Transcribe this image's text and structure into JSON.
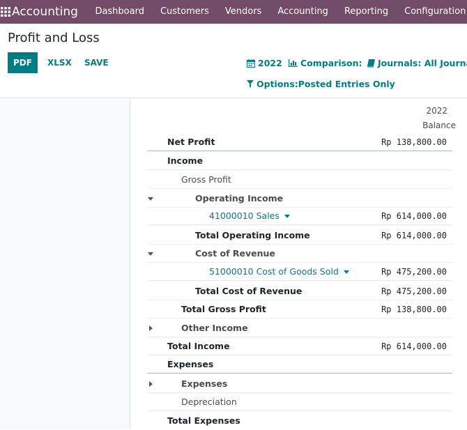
{
  "nav": {
    "brand": "Accounting",
    "menu": [
      "Dashboard",
      "Customers",
      "Vendors",
      "Accounting",
      "Reporting",
      "Configuration"
    ]
  },
  "control": {
    "title": "Profit and Loss",
    "pdf": "PDF",
    "xlsx": "XLSX",
    "save": "SAVE",
    "date_filter": "2022",
    "comparison": "Comparison:",
    "journals": "Journals: All Journals",
    "options": "Options:Posted Entries Only"
  },
  "report": {
    "column_year": "2022",
    "column_label": "Balance",
    "lines": [
      {
        "label": "Net Profit",
        "amount": "Rp 138,800.00"
      },
      {
        "label": "Income",
        "amount": ""
      },
      {
        "label": "Gross Profit",
        "amount": ""
      },
      {
        "label": "Operating Income",
        "amount": ""
      },
      {
        "label": "41000010 Sales",
        "amount": "Rp 614,000.00"
      },
      {
        "label": "Total Operating Income",
        "amount": "Rp 614,000.00"
      },
      {
        "label": "Cost of Revenue",
        "amount": ""
      },
      {
        "label": "51000010 Cost of Goods Sold",
        "amount": "Rp 475,200.00"
      },
      {
        "label": "Total Cost of Revenue",
        "amount": "Rp 475,200.00"
      },
      {
        "label": "Total Gross Profit",
        "amount": "Rp 138,800.00"
      },
      {
        "label": "Other Income",
        "amount": ""
      },
      {
        "label": "Total Income",
        "amount": "Rp 614,000.00"
      },
      {
        "label": "Expenses",
        "amount": ""
      },
      {
        "label": "Expenses",
        "amount": ""
      },
      {
        "label": "Depreciation",
        "amount": ""
      },
      {
        "label": "Total Expenses",
        "amount": ""
      }
    ]
  }
}
